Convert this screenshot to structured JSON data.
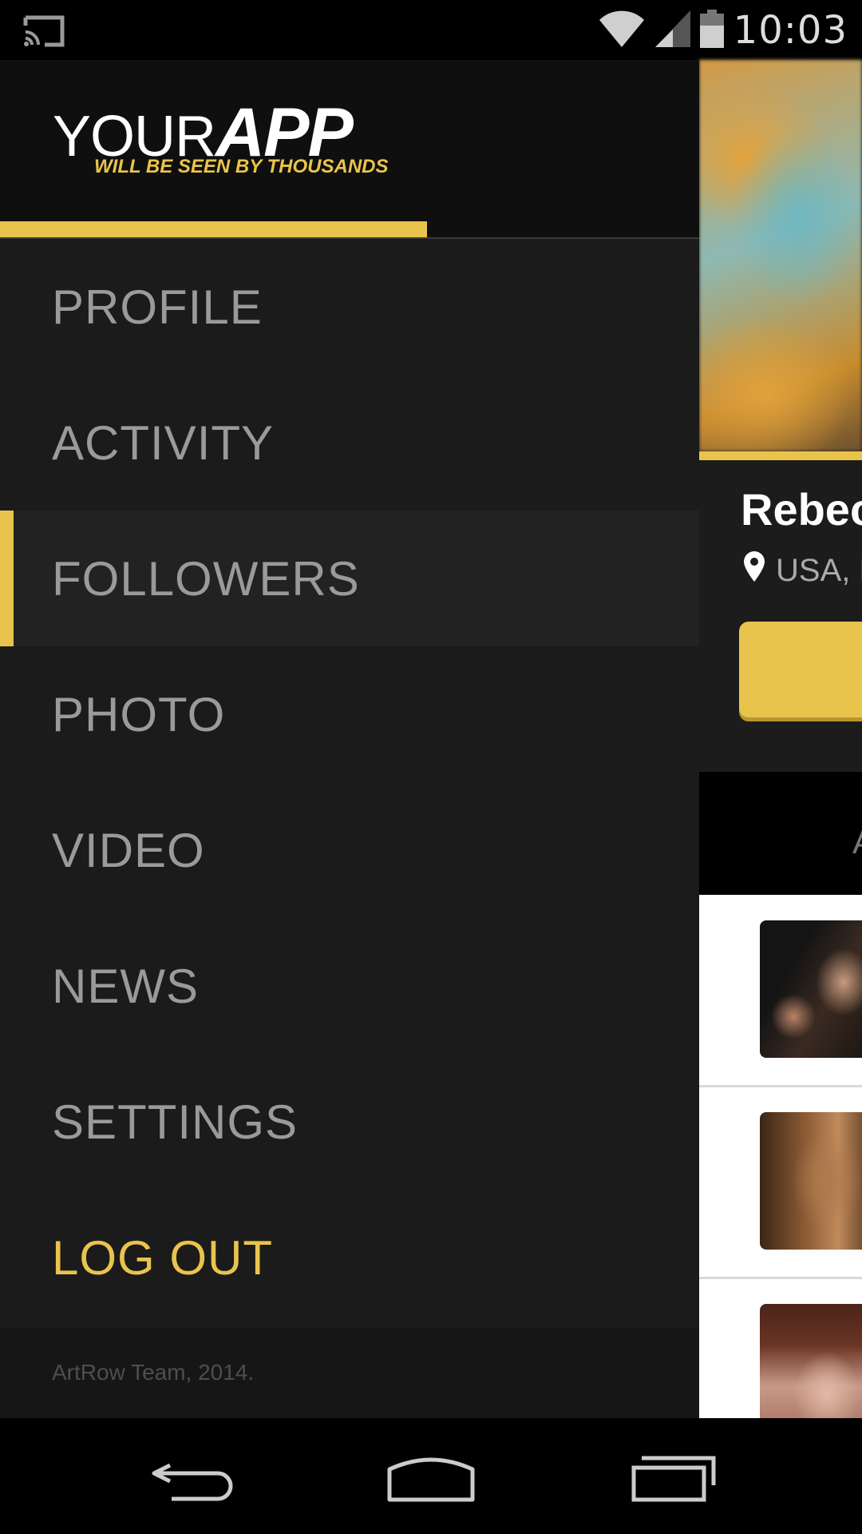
{
  "status_bar": {
    "time": "10:03",
    "icons": [
      "cast-icon",
      "wifi-icon",
      "signal-icon",
      "battery-icon"
    ]
  },
  "drawer": {
    "logo": {
      "part1": "YOUR",
      "part2": "APP",
      "tagline": "WILL BE SEEN BY THOUSANDS"
    },
    "menu_items": [
      {
        "label": "PROFILE",
        "active": false
      },
      {
        "label": "ACTIVITY",
        "active": false
      },
      {
        "label": "FOLLOWERS",
        "active": true
      },
      {
        "label": "PHOTO",
        "active": false
      },
      {
        "label": "VIDEO",
        "active": false
      },
      {
        "label": "NEWS",
        "active": false
      },
      {
        "label": "SETTINGS",
        "active": false
      },
      {
        "label": "LOG OUT",
        "active": false
      }
    ],
    "footer": "ArtRow Team, 2014."
  },
  "background_profile": {
    "name": "Rebec",
    "location": "USA, F",
    "tabs_partial_text": "A"
  },
  "nav_bar": {
    "buttons": [
      "back-icon",
      "home-icon",
      "recents-icon"
    ]
  },
  "colors": {
    "accent": "#e9c44c",
    "drawer_bg": "#1b1b1b",
    "menu_text": "#9a9a9a"
  }
}
